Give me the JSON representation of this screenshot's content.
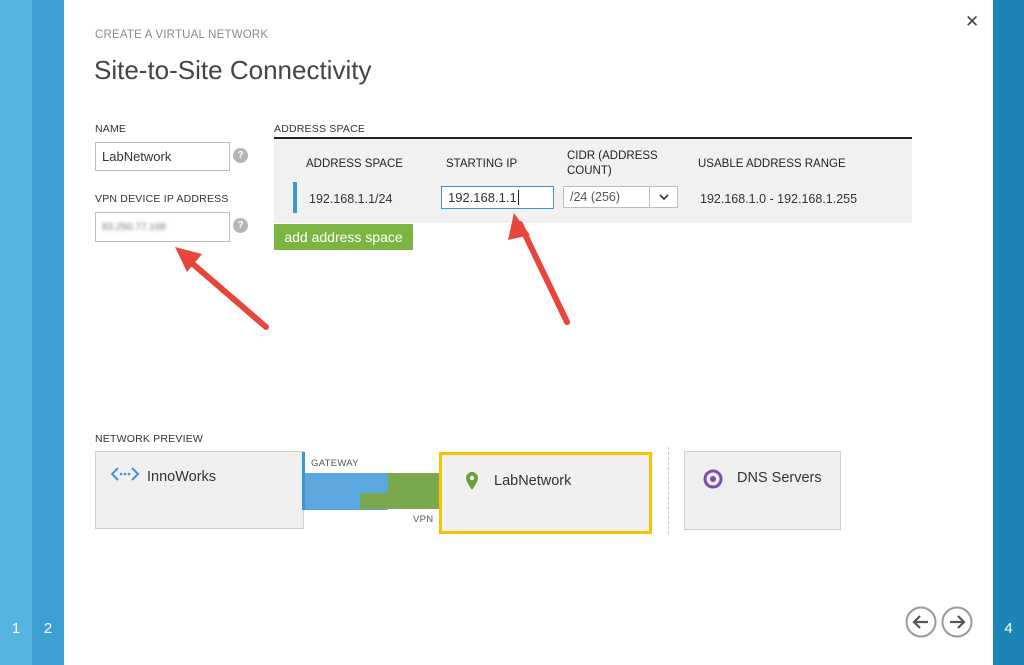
{
  "wizard": {
    "subtitle": "CREATE A VIRTUAL NETWORK",
    "title": "Site-to-Site Connectivity",
    "steps": [
      "1",
      "2",
      "4"
    ],
    "close_icon": "close-icon"
  },
  "form": {
    "name_label": "NAME",
    "name_value": "LabNetwork",
    "vpn_label": "VPN DEVICE IP ADDRESS",
    "vpn_value": "83.250.77.168",
    "help_glyph": "?"
  },
  "address_space": {
    "section_label": "ADDRESS SPACE",
    "columns": [
      "ADDRESS SPACE",
      "STARTING IP",
      "CIDR (ADDRESS COUNT)",
      "USABLE ADDRESS RANGE"
    ],
    "rows": [
      {
        "address_space": "192.168.1.1/24",
        "starting_ip": "192.168.1.1",
        "cidr": "/24 (256)",
        "usable_range": "192.168.1.0 - 192.168.1.255"
      }
    ],
    "add_button_label": "add address space"
  },
  "preview": {
    "section_label": "NETWORK PREVIEW",
    "local_site": "InnoWorks",
    "gateway_label": "GATEWAY",
    "vpn_label": "VPN",
    "virtual_network": "LabNetwork",
    "dns_label": "DNS Servers"
  },
  "colors": {
    "accent_blue": "#3e93d1",
    "green": "#7db542",
    "highlight_yellow": "#f5c400",
    "annotation_red": "#e8453c"
  }
}
